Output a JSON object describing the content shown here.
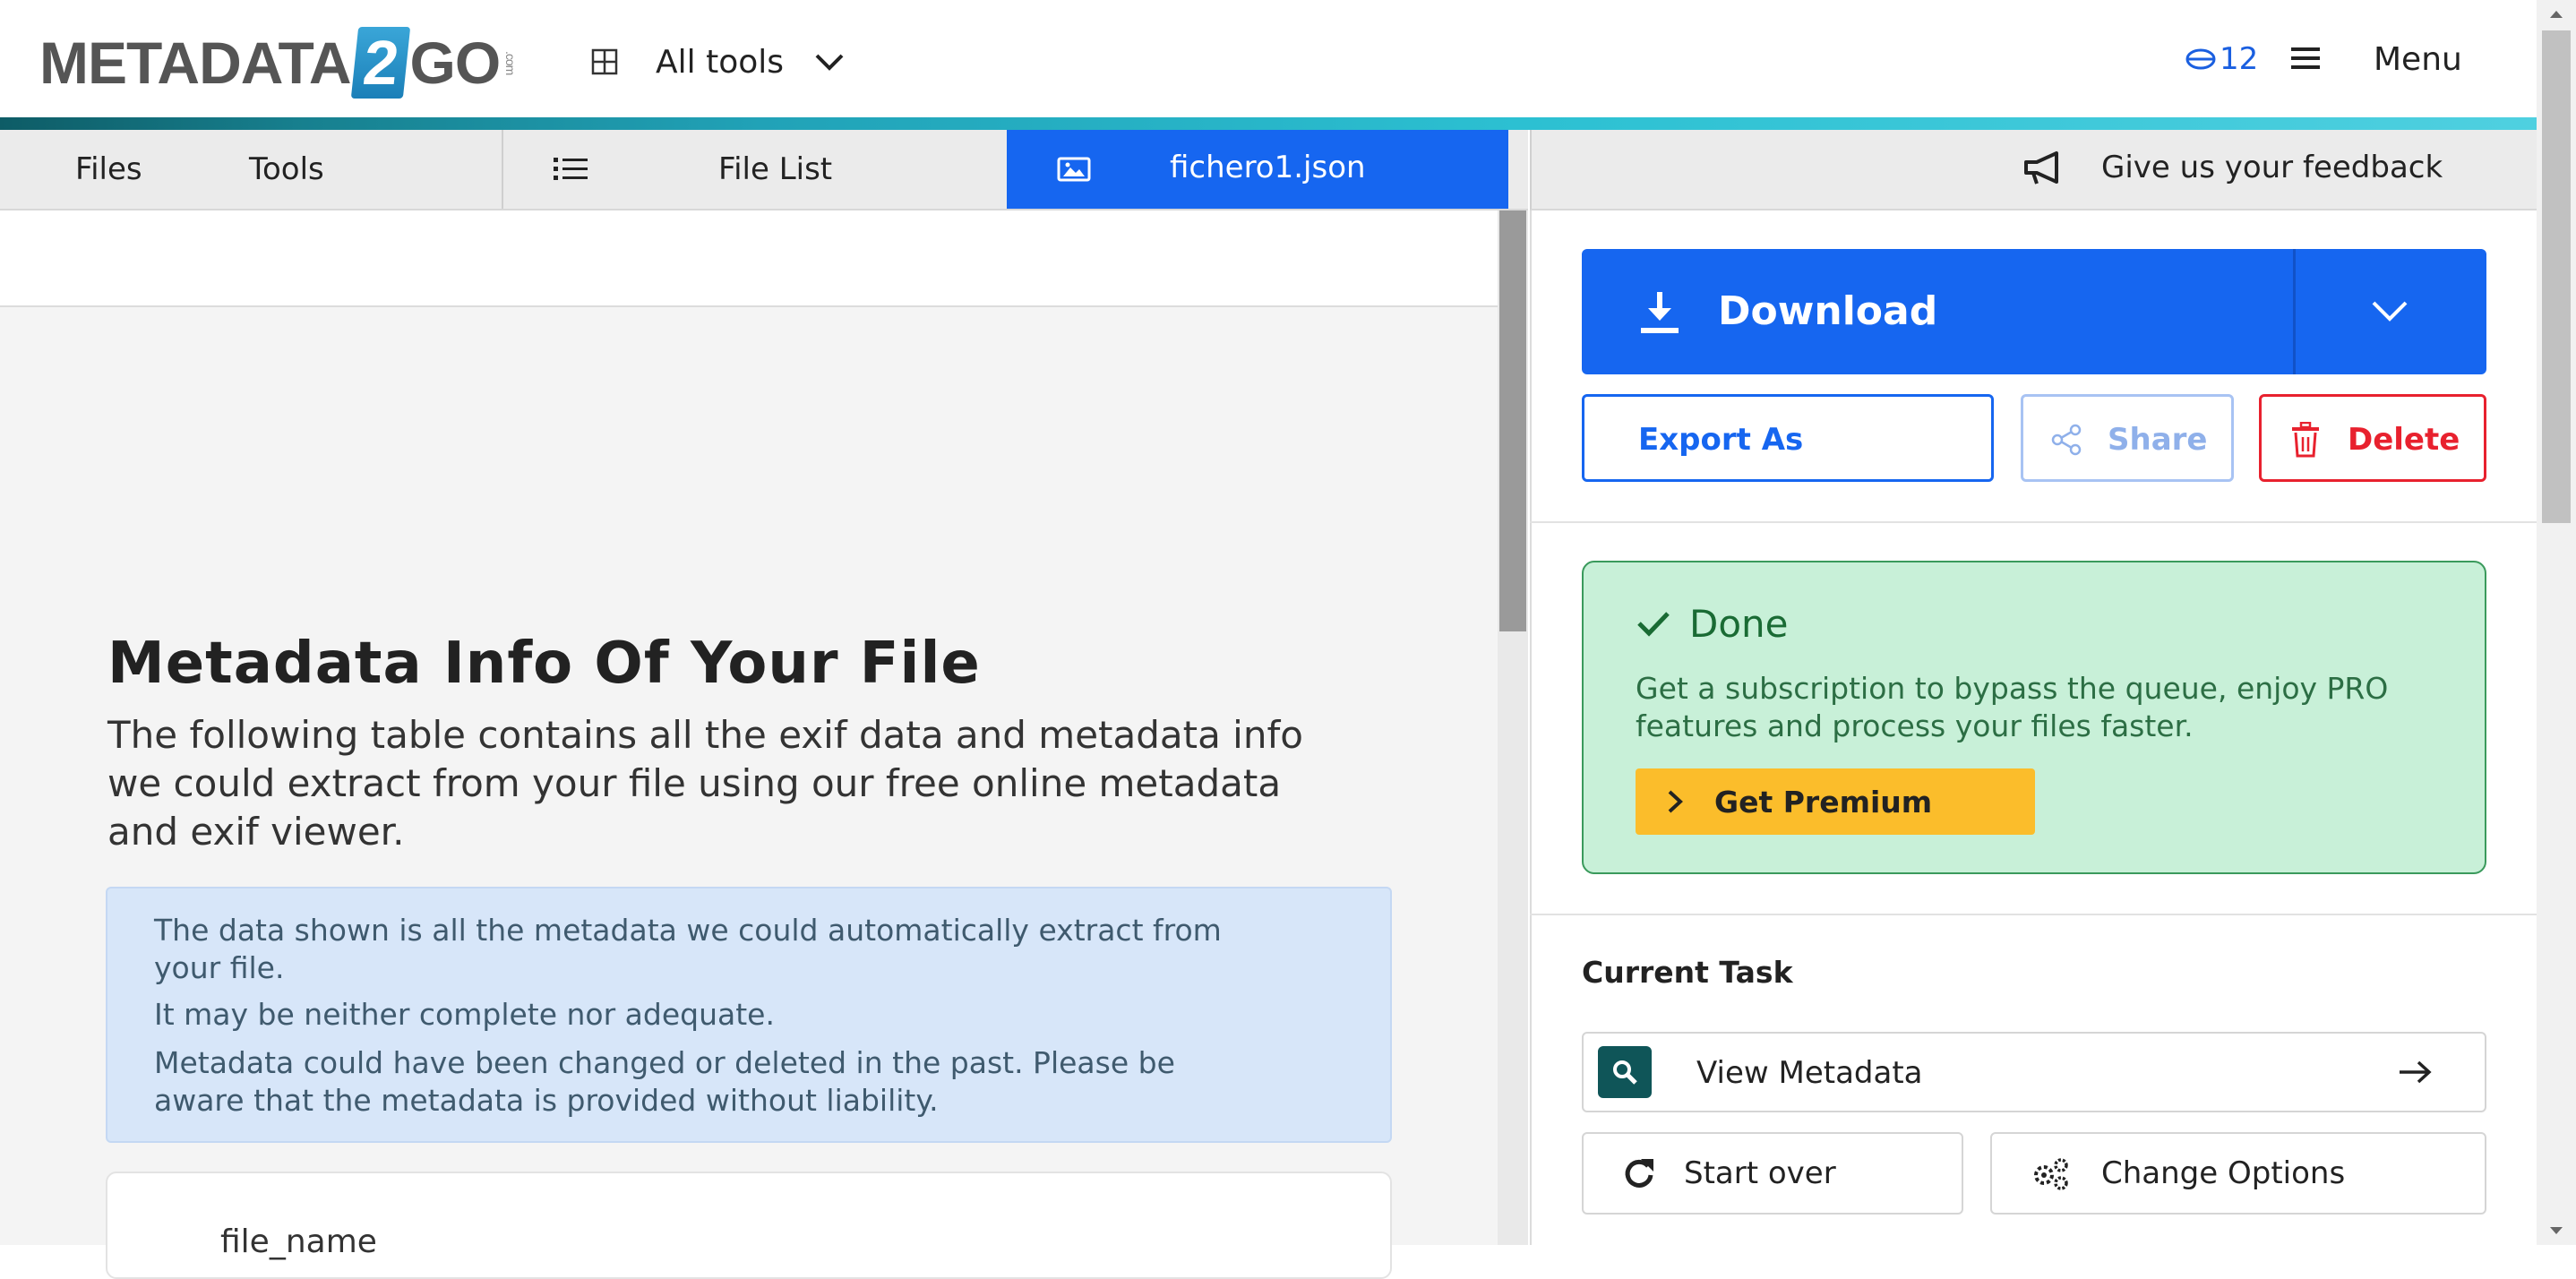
{
  "header": {
    "logo_text_left": "METADATA",
    "logo_text_num": "2",
    "logo_text_right": "GO",
    "logo_dotcom": ".com",
    "all_tools_label": "All tools",
    "credits": "12",
    "menu_label": "Menu"
  },
  "tabs": {
    "files": "Files",
    "tools": "Tools",
    "file_list": "File List",
    "active_file": "fichero1.json",
    "feedback": "Give us your feedback"
  },
  "main": {
    "title": "Metadata Info Of Your File",
    "description": "The following table contains all the exif data and metadata info we could extract from your file using our free online metadata and exif viewer.",
    "info": [
      "The data shown is all the metadata we could automatically extract from",
      "your file.",
      "It may be neither complete nor adequate.",
      "Metadata could have been changed or deleted in the past. Please be",
      "aware that the metadata is provided without liability."
    ],
    "first_key": "file_name"
  },
  "panel": {
    "download_label": "Download",
    "export_label": "Export As",
    "share_label": "Share",
    "delete_label": "Delete",
    "done_title": "Done",
    "done_message": "Get a subscription to bypass the queue, enjoy PRO features and process your files faster.",
    "premium_label": "Get Premium",
    "current_task_heading": "Current Task",
    "task_label": "View Metadata",
    "start_over_label": "Start over",
    "change_options_label": "Change Options"
  },
  "colors": {
    "primary": "#1666f0",
    "teal": "#0f5558",
    "success_bg": "#c8f0d8",
    "success_text": "#1a6b34",
    "premium": "#fbbd2b",
    "danger": "#e8212e",
    "info_bg": "#d7e6f9"
  },
  "icons": [
    "grid-icon",
    "chevron-down-icon",
    "coin-icon",
    "hamburger-icon",
    "list-icon",
    "image-icon",
    "megaphone-icon",
    "download-icon",
    "share-icon",
    "trash-icon",
    "check-icon",
    "chevron-right-icon",
    "search-icon",
    "arrow-right-icon",
    "restart-icon",
    "gears-icon"
  ]
}
